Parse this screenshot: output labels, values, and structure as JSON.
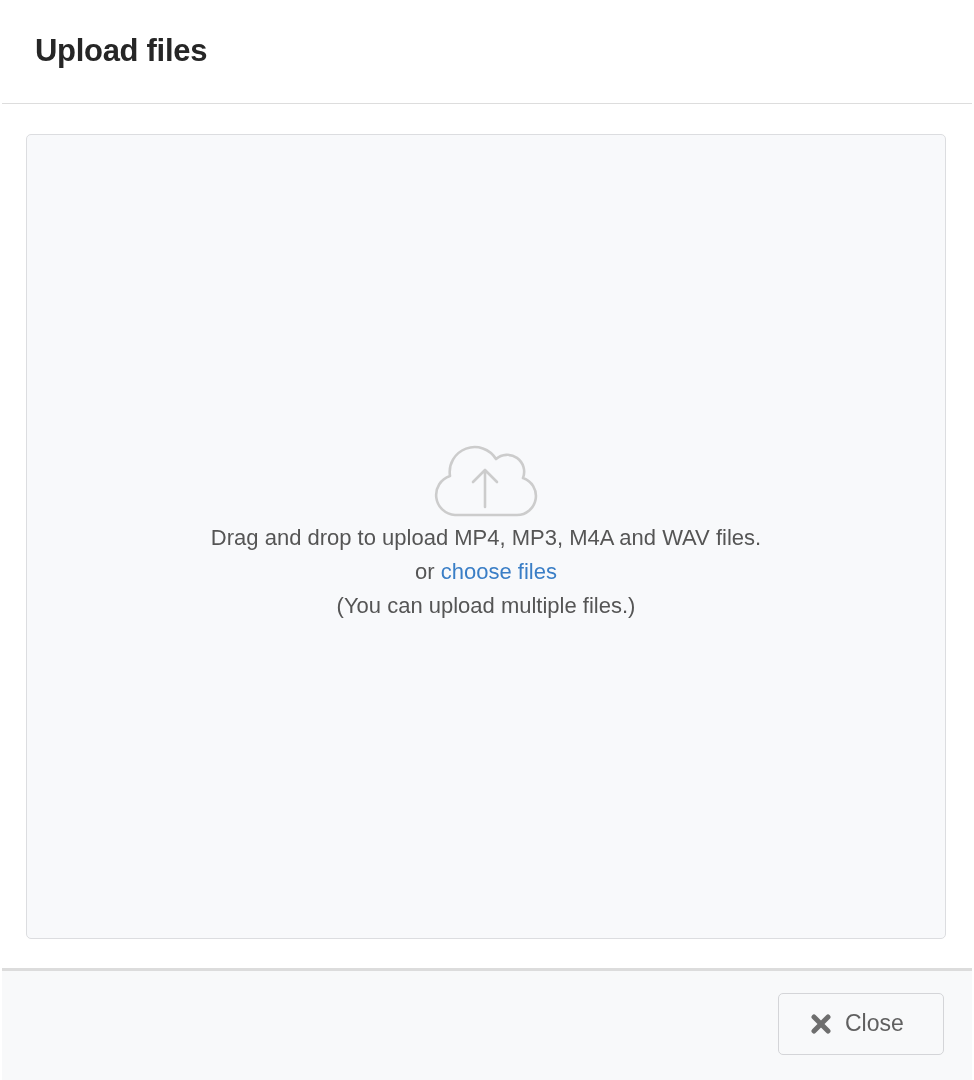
{
  "dialog": {
    "title": "Upload files"
  },
  "dropzone": {
    "instruction": "Drag and drop to upload MP4, MP3, M4A and WAV files.",
    "alternative_prefix": "or",
    "link": "choose files",
    "note": "(You can upload multiple files.)"
  },
  "footer": {
    "buttons": [
      {
        "label": "Close",
        "kind": "close"
      }
    ]
  }
}
